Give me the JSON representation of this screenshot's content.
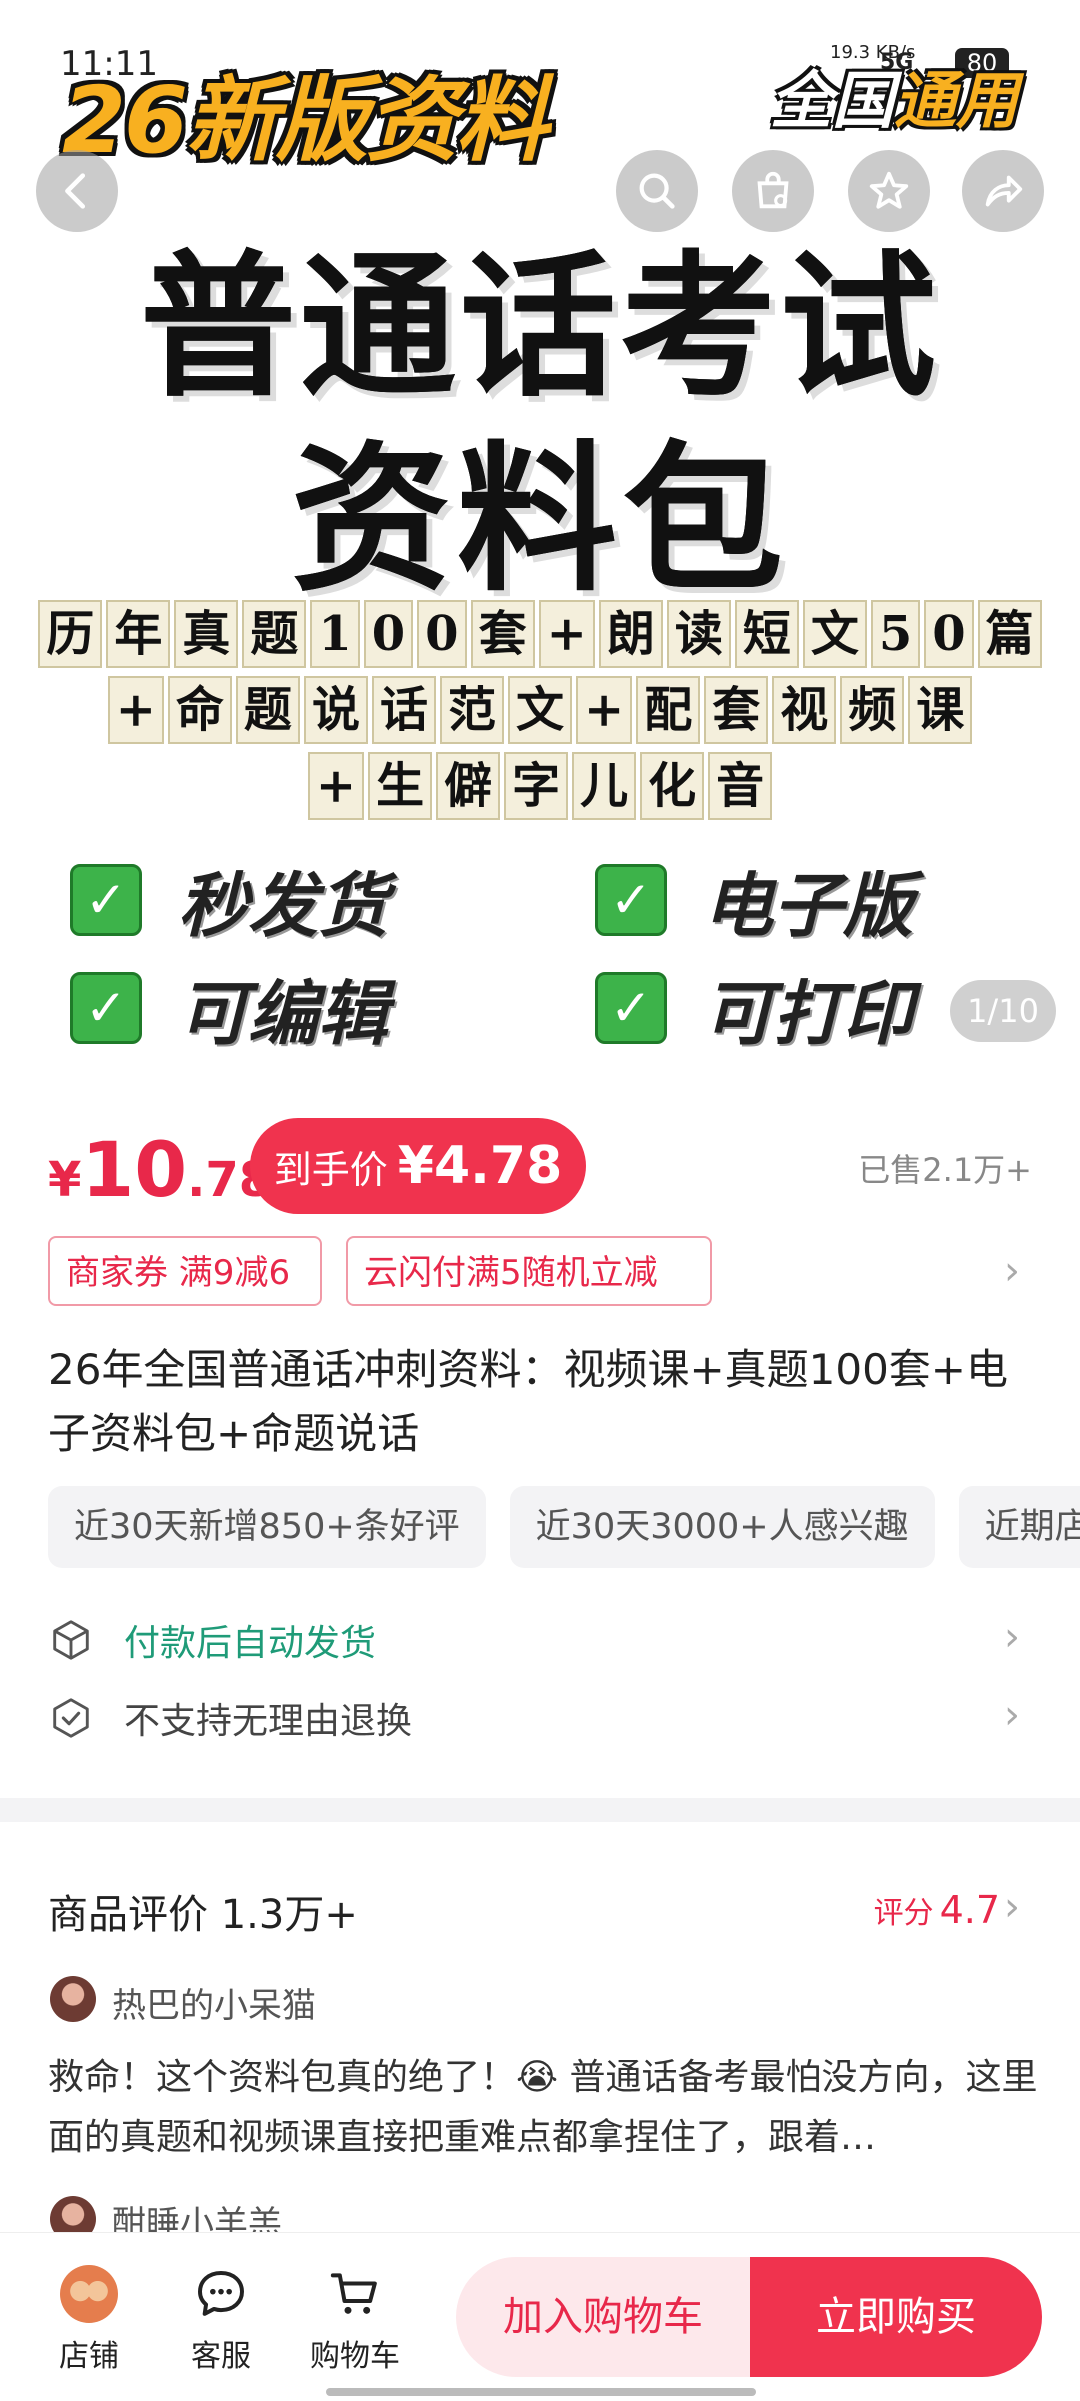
{
  "status_bar": {
    "time": "11:11",
    "network_speed": "19.3 KB/s",
    "signal": "5G",
    "battery": "80"
  },
  "hero": {
    "corner_left": "26新版资料",
    "corner_right_a": "全国",
    "corner_right_b": "通用",
    "title_line1": "普通话考试",
    "title_line2": "资料包",
    "sub_line1": [
      "历",
      "年",
      "真",
      "题",
      "1",
      "0",
      "0",
      "套",
      "+",
      "朗",
      "读",
      "短",
      "文",
      "5",
      "0",
      "篇"
    ],
    "sub_line2": [
      "+",
      "命",
      "题",
      "说",
      "话",
      "范",
      "文",
      "+",
      "配",
      "套",
      "视",
      "频",
      "课"
    ],
    "sub_line3": [
      "+",
      "生",
      "僻",
      "字",
      "儿",
      "化",
      "音"
    ],
    "features": [
      "秒发货",
      "电子版",
      "可编辑",
      "可打印"
    ],
    "pager": "1/10"
  },
  "price": {
    "currency": "¥",
    "integer": "10",
    "decimal": ".78"
  },
  "final_price": {
    "label": "到手价",
    "value": "¥4.78"
  },
  "sold": "已售2.1万+",
  "coupons": [
    "商家券 满9减6",
    "云闪付满5随机立减"
  ],
  "product_title": "26年全国普通话冲刺资料：视频课+真题100套+电子资料包+命题说话",
  "tags": [
    "近30天新增850+条好评",
    "近30天3000+人感兴趣",
    "近期店"
  ],
  "services": [
    {
      "text": "付款后自动发货",
      "icon": "package-icon"
    },
    {
      "text": "不支持无理由退换",
      "icon": "shield-check-icon"
    }
  ],
  "reviews": {
    "title": "商品评价 1.3万+",
    "score_label": "评分",
    "score": "4.7",
    "items": [
      {
        "user": "热巴的小呆猫",
        "text": "救命！这个资料包真的绝了！😭 普通话备考最怕没方向，这里面的真题和视频课直接把重难点都拿捏住了，跟着…"
      },
      {
        "user": "酣睡小羊羔",
        "text": ""
      }
    ]
  },
  "bottom_bar": {
    "shop": "店铺",
    "service": "客服",
    "cart": "购物车",
    "add_to_cart": "加入购物车",
    "buy_now": "立即购买"
  },
  "colors": {
    "accent": "#f0334e",
    "price": "#e8284a",
    "service_green": "#1f9b78"
  }
}
